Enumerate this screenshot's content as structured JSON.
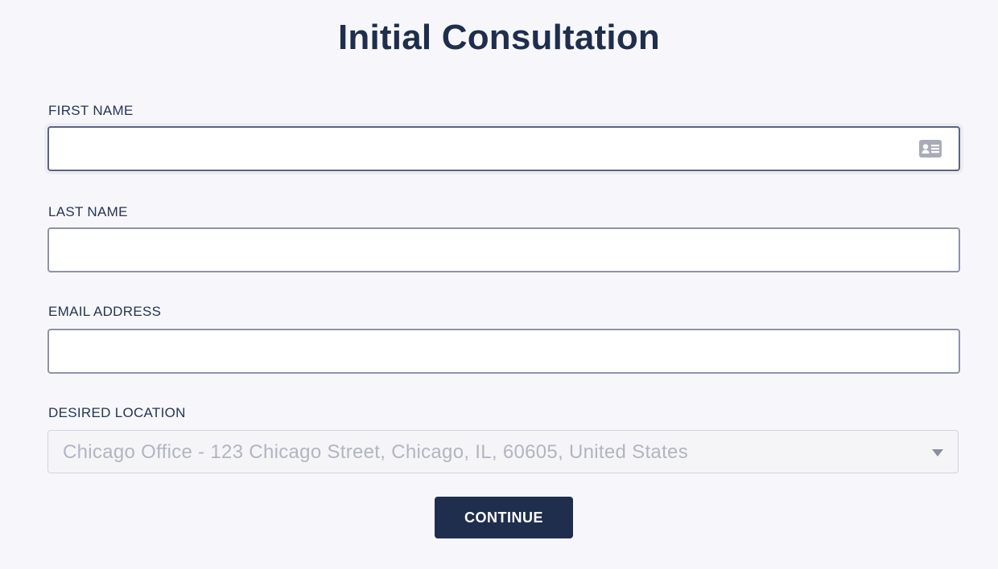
{
  "form": {
    "title": "Initial Consultation",
    "fields": {
      "first_name": {
        "label": "FIRST NAME",
        "value": "",
        "icon": "contact-card-icon"
      },
      "last_name": {
        "label": "LAST NAME",
        "value": ""
      },
      "email": {
        "label": "EMAIL ADDRESS",
        "value": ""
      },
      "location": {
        "label": "DESIRED LOCATION",
        "selected": "Chicago Office - 123 Chicago Street, Chicago, IL, 60605, United States"
      }
    },
    "continue_label": "CONTINUE"
  },
  "colors": {
    "background": "#f7f7fb",
    "primary": "#1f2e4d",
    "input_border": "#8f93a8",
    "placeholder_text": "#b2b5c1"
  }
}
